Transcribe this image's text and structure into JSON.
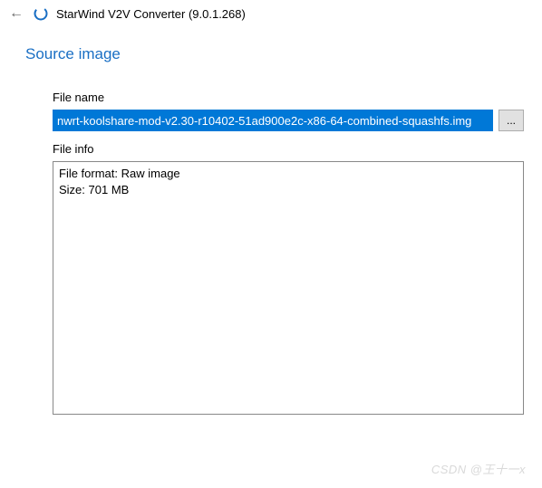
{
  "header": {
    "app_title": "StarWind V2V Converter (9.0.1.268)"
  },
  "page": {
    "heading": "Source image"
  },
  "file_name": {
    "label": "File name",
    "value": "nwrt-koolshare-mod-v2.30-r10402-51ad900e2c-x86-64-combined-squashfs.img",
    "browse_label": "..."
  },
  "file_info": {
    "label": "File info",
    "format_line": "File format: Raw image",
    "size_line": "Size: 701 MB"
  },
  "watermark": "CSDN @王十一x"
}
